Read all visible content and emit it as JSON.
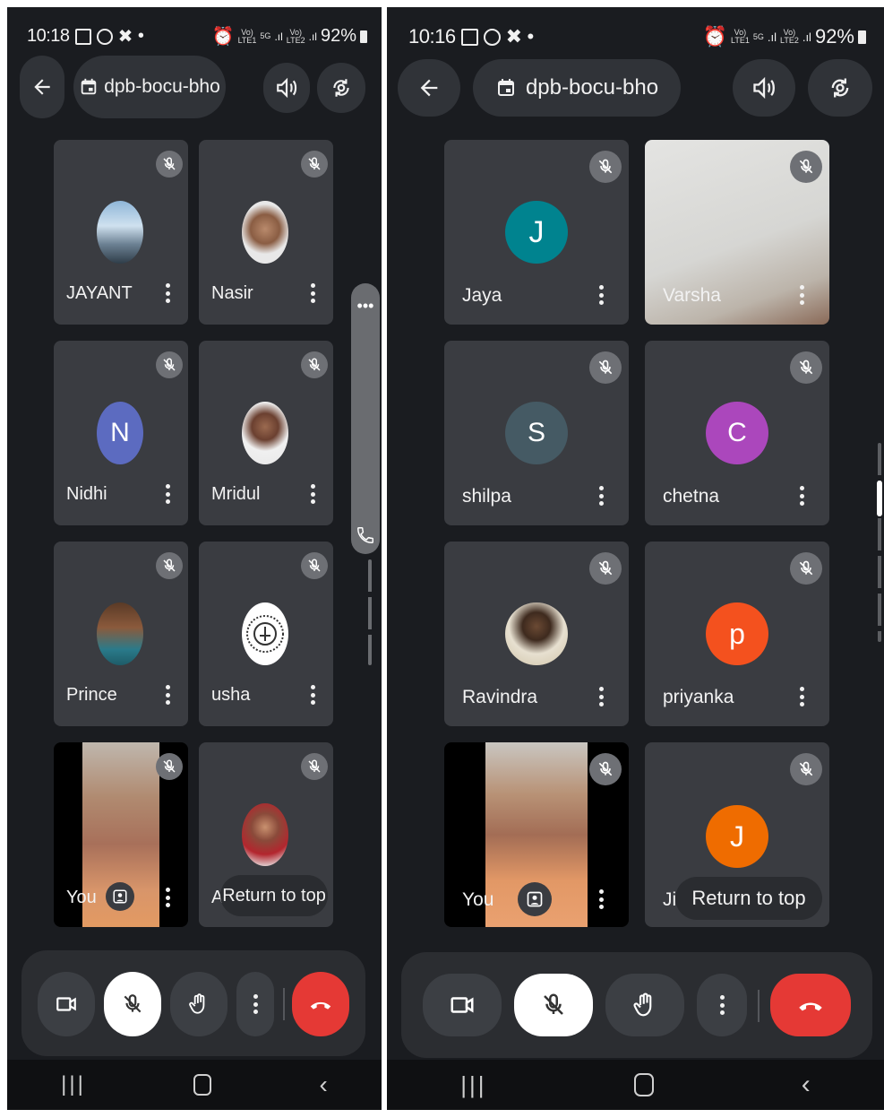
{
  "left": {
    "status": {
      "time": "10:18",
      "battery": "92%",
      "net1": "Vo)",
      "net1b": "LTE1",
      "net2": "5G",
      "net3": "Vo)",
      "net3b": "LTE2"
    },
    "header": {
      "meeting_code": "dpb-bocu-bho"
    },
    "tiles": [
      {
        "name": "JAYANT"
      },
      {
        "name": "Nasir"
      },
      {
        "name": "Nidhi",
        "initial": "N"
      },
      {
        "name": "Mridul"
      },
      {
        "name": "Prince"
      },
      {
        "name": "usha"
      },
      {
        "name": "You"
      },
      {
        "name": "A"
      }
    ],
    "return_to_top": "Return to top"
  },
  "right": {
    "status": {
      "time": "10:16",
      "battery": "92%",
      "net1": "Vo)",
      "net1b": "LTE1",
      "net2": "5G",
      "net3": "Vo)",
      "net3b": "LTE2"
    },
    "header": {
      "meeting_code": "dpb-bocu-bho"
    },
    "tiles": [
      {
        "name": "Jaya",
        "initial": "J"
      },
      {
        "name": "Varsha"
      },
      {
        "name": "shilpa",
        "initial": "S"
      },
      {
        "name": "chetna",
        "initial": "C"
      },
      {
        "name": "Ravindra"
      },
      {
        "name": "priyanka",
        "initial": "p"
      },
      {
        "name": "You"
      },
      {
        "name": "Ji",
        "initial": "J"
      }
    ],
    "return_to_top": "Return to top"
  },
  "colors": {
    "jaya": "#00838f",
    "nidhi": "#5c6bc0",
    "shilpa": "#455a64",
    "chetna": "#ab47bc",
    "priyanka": "#f4511e",
    "ji": "#ef6c00",
    "end_call": "#e53935"
  },
  "icons": {
    "back": "arrow-left",
    "calendar": "calendar",
    "speaker": "speaker",
    "switch_camera": "camera-switch",
    "mic_off": "mic-off",
    "more": "more-vert",
    "camera": "video-camera",
    "raise_hand": "hand",
    "end_call": "phone-hangup",
    "effects": "portrait-effects",
    "phone": "phone",
    "recents": "nav-recents",
    "home": "nav-home",
    "back_nav": "nav-back"
  }
}
